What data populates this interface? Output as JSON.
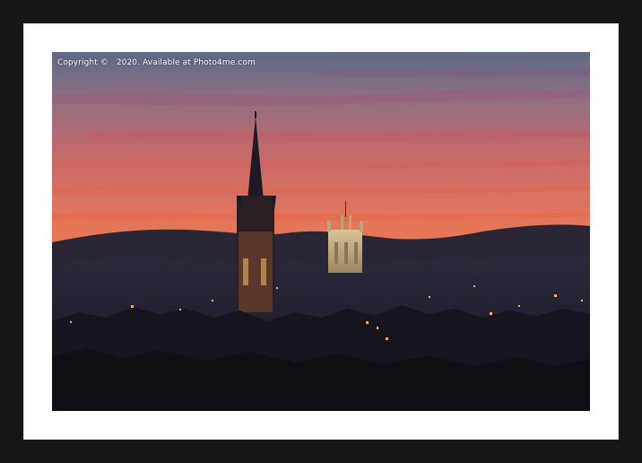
{
  "watermark": {
    "text": "Copyright ©   2020. Available at Photo4me.com"
  },
  "colors": {
    "frame": "#161616",
    "mount": "#ffffff",
    "sky_top": "#5d6a86",
    "sky_mid": "#c46a6a",
    "sky_glow": "#f07a4a",
    "silhouette": "#1a1a2a",
    "tower_light": "#c9b48a"
  }
}
